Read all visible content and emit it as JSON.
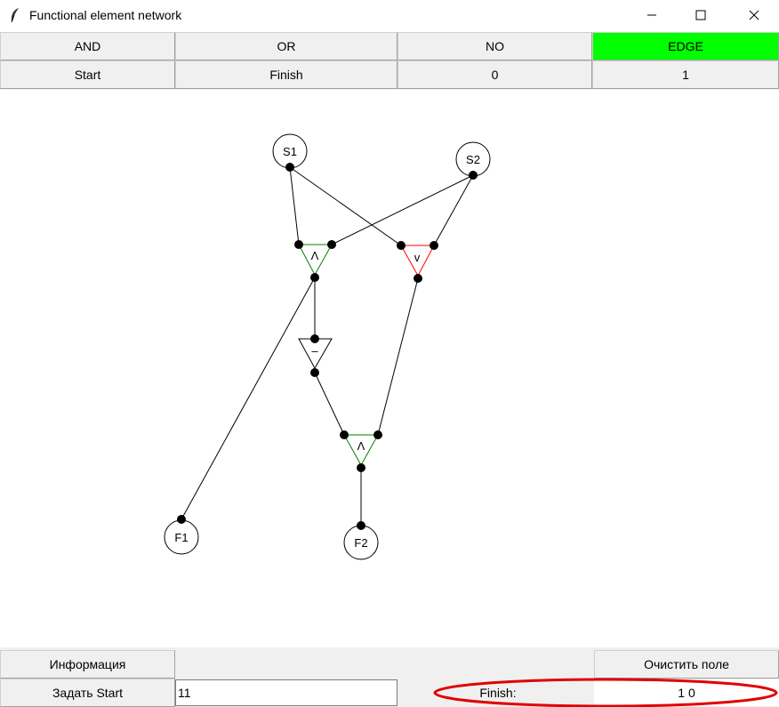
{
  "window": {
    "title": "Functional element network"
  },
  "toolbar_row1": [
    "AND",
    "OR",
    "NO",
    "EDGE"
  ],
  "toolbar_row2": [
    "Start",
    "Finish",
    "0",
    "1"
  ],
  "active_color": "#00ff00",
  "nodes": {
    "s1": "S1",
    "s2": "S2",
    "f1": "F1",
    "f2": "F2"
  },
  "gates": {
    "and_top": "Λ",
    "or_top": "v",
    "not_gate": "–",
    "and_bottom": "Λ"
  },
  "gate_colors": {
    "and": "#008000",
    "or": "#ff0000",
    "not": "#000000"
  },
  "bottom": {
    "info_button": "Информация",
    "clear_button": "Очистить поле",
    "set_start_button": "Задать Start",
    "start_input_value": "11",
    "finish_label": "Finish:",
    "finish_value": "1 0"
  },
  "annotation_color": "#e00000"
}
